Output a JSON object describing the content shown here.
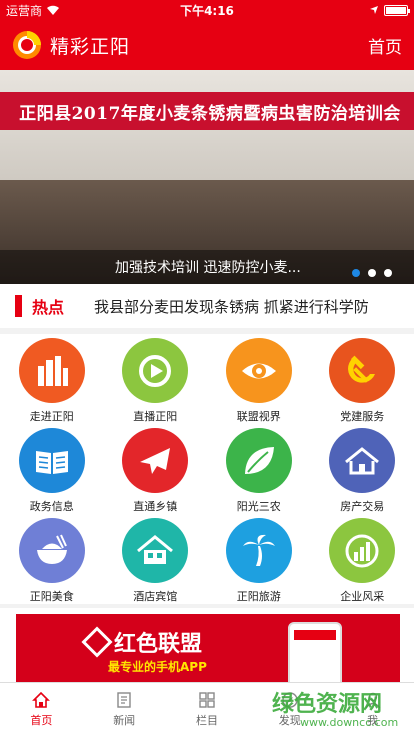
{
  "status_bar": {
    "carrier": "运营商",
    "time": "下午4:16"
  },
  "header": {
    "title": "精彩正阳",
    "home_link": "首页"
  },
  "banner": {
    "sign_text": "正阳县2017年度小麦条锈病暨病虫害防治培训会",
    "caption": "加强技术培训 迅速防控小麦...",
    "slide_count": 3,
    "active_slide": 1
  },
  "hot": {
    "label": "热点",
    "headline": "我县部分麦田发现条锈病 抓紧进行科学防"
  },
  "grid": {
    "items": [
      {
        "label": "走进正阳",
        "icon": "city-buildings-icon",
        "color": "#f05a22"
      },
      {
        "label": "直播正阳",
        "icon": "live-play-icon",
        "color": "#8cc63f"
      },
      {
        "label": "联盟视界",
        "icon": "eye-icon",
        "color": "#f7941d"
      },
      {
        "label": "党建服务",
        "icon": "hammer-sickle-icon",
        "color": "#e8541e"
      },
      {
        "label": "政务信息",
        "icon": "open-book-icon",
        "color": "#1e88d8"
      },
      {
        "label": "直通乡镇",
        "icon": "airplane-icon",
        "color": "#e3262a"
      },
      {
        "label": "阳光三农",
        "icon": "leaf-icon",
        "color": "#3cb44a"
      },
      {
        "label": "房产交易",
        "icon": "house-icon",
        "color": "#4f63b8"
      },
      {
        "label": "正阳美食",
        "icon": "rice-bowl-icon",
        "color": "#6f7fd6"
      },
      {
        "label": "酒店宾馆",
        "icon": "hotel-house-icon",
        "color": "#1fb6a8"
      },
      {
        "label": "正阳旅游",
        "icon": "palm-tree-icon",
        "color": "#1ea0e0"
      },
      {
        "label": "企业风采",
        "icon": "growth-chart-icon",
        "color": "#8cc63f"
      }
    ]
  },
  "ad": {
    "title": "红色联盟",
    "subtitle": "最专业的手机APP"
  },
  "tabbar": {
    "tabs": [
      {
        "label": "首页",
        "icon": "home-icon"
      },
      {
        "label": "新闻",
        "icon": "news-icon"
      },
      {
        "label": "栏目",
        "icon": "grid-icon"
      },
      {
        "label": "发现",
        "icon": "compass-icon"
      },
      {
        "label": "我",
        "icon": "user-icon"
      }
    ]
  },
  "watermark": {
    "name": "绿色资源网",
    "url": "www.downcc.com"
  }
}
